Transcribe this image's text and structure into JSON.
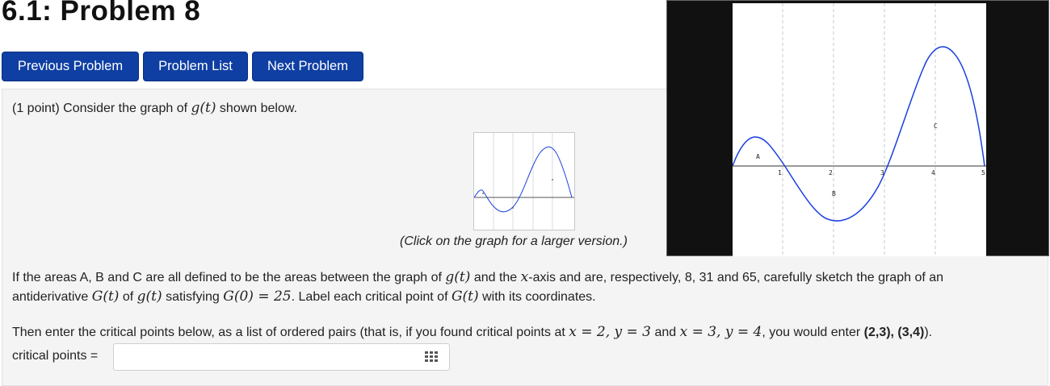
{
  "page": {
    "title": "6.1: Problem 8"
  },
  "nav": {
    "previous_label": "Previous Problem",
    "list_label": "Problem List",
    "next_label": "Next Problem"
  },
  "problem": {
    "points": "(1 point)",
    "intro": "Consider the graph of",
    "intro_func": "g(t)",
    "intro_end": "shown below.",
    "caption": "(Click on the graph for a larger version.)",
    "p1_a": "If the areas A, B and C are all defined to be the areas between the graph of",
    "p1_func": "g(t)",
    "p1_and": "and the",
    "p1_x": "x",
    "p1_b": "-axis and are, respectively, 8, 31 and 65, carefully sketch the graph of an",
    "p2_a": "antiderivative",
    "p2_G": "G(t)",
    "p2_of": "of",
    "p2_g": "g(t)",
    "p2_sat": "satisfying",
    "p2_cond": "G(0) = 25",
    "p2_b": ". Label each critical point of",
    "p2_G2": "G(t)",
    "p2_c": "with its coordinates.",
    "p3_a": "Then enter the critical points below, as a list of ordered pairs (that is, if you found critical points at",
    "p3_m1": "x = 2, y = 3",
    "p3_and": "and",
    "p3_m2": "x = 3, y = 4",
    "p3_b": ", you would enter",
    "p3_example": "(2,3), (3,4)",
    "p3_end": ").",
    "answer_label": "critical points =",
    "answer_value": ""
  },
  "graph": {
    "area_labels": [
      "A",
      "B",
      "C"
    ],
    "x_ticks": [
      "1",
      "2",
      "3",
      "4",
      "5"
    ],
    "curve_color": "#1a3fe0"
  }
}
